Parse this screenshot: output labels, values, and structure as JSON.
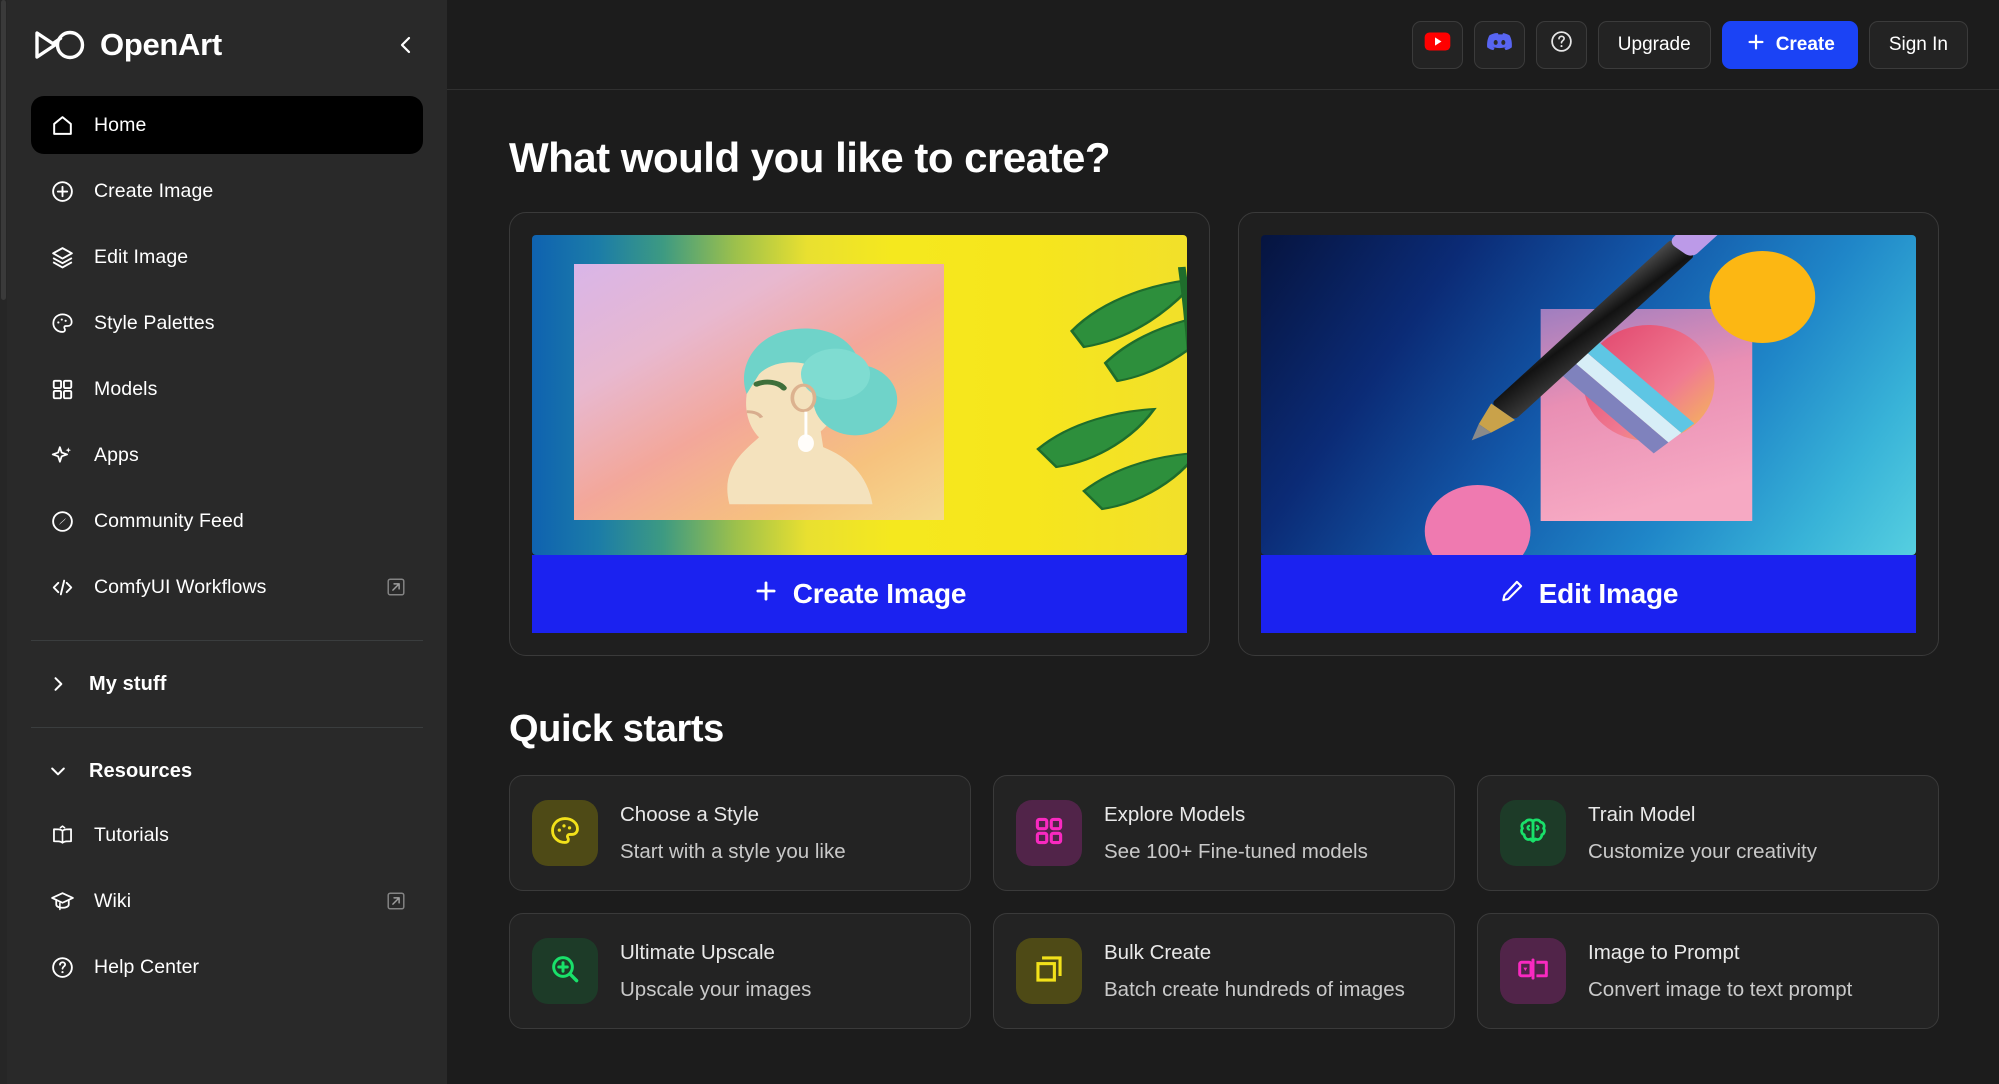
{
  "brand": {
    "name": "OpenArt",
    "logo_icon": "openart-infinity-logo",
    "collapse_icon": "chevron-left-icon"
  },
  "sidebar": {
    "items": [
      {
        "label": "Home",
        "icon": "home-icon",
        "active": true,
        "external": false
      },
      {
        "label": "Create Image",
        "icon": "plus-circle-icon",
        "active": false,
        "external": false
      },
      {
        "label": "Edit Image",
        "icon": "layers-icon",
        "active": false,
        "external": false
      },
      {
        "label": "Style Palettes",
        "icon": "palette-icon",
        "active": false,
        "external": false
      },
      {
        "label": "Models",
        "icon": "grid-icon",
        "active": false,
        "external": false
      },
      {
        "label": "Apps",
        "icon": "sparkle-icon",
        "active": false,
        "external": false
      },
      {
        "label": "Community Feed",
        "icon": "compass-icon",
        "active": false,
        "external": false
      },
      {
        "label": "ComfyUI Workflows",
        "icon": "code-icon",
        "active": false,
        "external": true
      }
    ],
    "my_stuff": {
      "label": "My stuff",
      "chevron": "chevron-right-icon",
      "expanded": false
    },
    "resources": {
      "label": "Resources",
      "chevron": "chevron-down-icon",
      "expanded": true
    },
    "resource_items": [
      {
        "label": "Tutorials",
        "icon": "book-open-icon",
        "external": false
      },
      {
        "label": "Wiki",
        "icon": "graduation-cap-icon",
        "external": true
      },
      {
        "label": "Help Center",
        "icon": "question-circle-icon",
        "external": false
      }
    ],
    "external_icon": "external-link-icon"
  },
  "topbar": {
    "youtube": {
      "label": "",
      "icon": "youtube-icon",
      "color": "#ff0000"
    },
    "discord": {
      "label": "",
      "icon": "discord-icon",
      "color": "#5865f2"
    },
    "help": {
      "label": "",
      "icon": "question-circle-icon"
    },
    "upgrade_label": "Upgrade",
    "create_label": "Create",
    "create_icon": "plus-icon",
    "create_color": "#1b43f5",
    "signin_label": "Sign In"
  },
  "main": {
    "page_title": "What would you like to create?",
    "hero_cards": [
      {
        "cta_label": "Create Image",
        "cta_icon": "plus-icon",
        "art": "woman-portrait-yellow-leaves"
      },
      {
        "cta_label": "Edit Image",
        "cta_icon": "pencil-icon",
        "art": "stylus-pen-blue-shapes"
      }
    ],
    "section_title": "Quick starts",
    "quick_starts": [
      {
        "title": "Choose a Style",
        "subtitle": "Start with a style you like",
        "icon": "palette-icon",
        "icon_color": "#f2e11a",
        "tile_color": "#4e4a16"
      },
      {
        "title": "Explore Models",
        "subtitle": "See 100+ Fine-tuned models",
        "icon": "grid-icon",
        "icon_color": "#f929c0",
        "tile_color": "#512449"
      },
      {
        "title": "Train Model",
        "subtitle": "Customize your creativity",
        "icon": "brain-icon",
        "icon_color": "#19e06a",
        "tile_color": "#1d3b28"
      },
      {
        "title": "Ultimate Upscale",
        "subtitle": "Upscale your images",
        "icon": "zoom-in-icon",
        "icon_color": "#19e06a",
        "tile_color": "#1d3b28"
      },
      {
        "title": "Bulk Create",
        "subtitle": "Batch create hundreds of images",
        "icon": "copy-icon",
        "icon_color": "#f2e11a",
        "tile_color": "#4e4a16"
      },
      {
        "title": "Image to Prompt",
        "subtitle": "Convert image to text prompt",
        "icon": "image-to-text-icon",
        "icon_color": "#f929c0",
        "tile_color": "#512449"
      }
    ]
  }
}
